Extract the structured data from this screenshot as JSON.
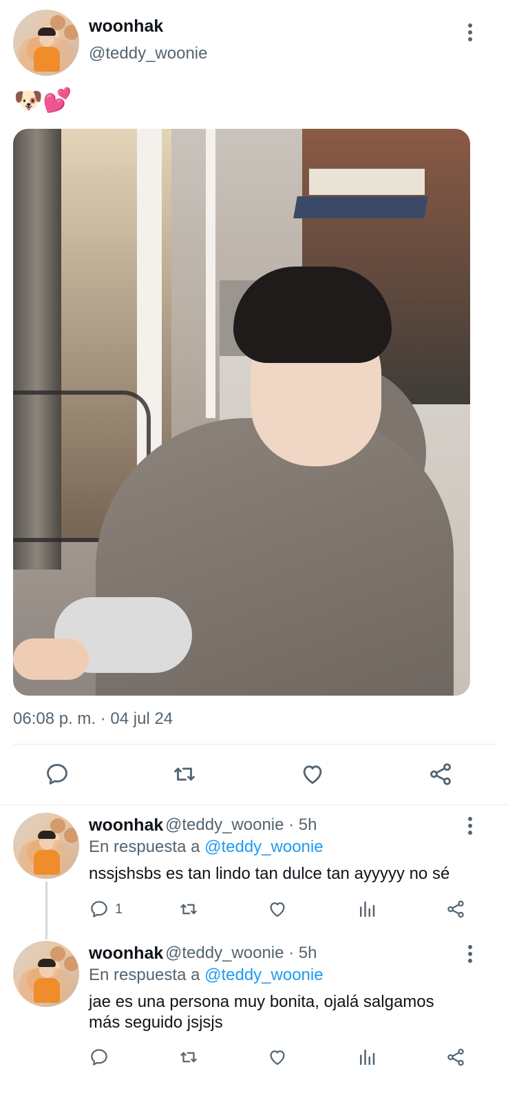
{
  "main_tweet": {
    "name": "woonhak",
    "handle": "@teddy_woonie",
    "text": "🐶💕",
    "timestamp": "06:08 p. m. · 04 jul 24"
  },
  "replies": [
    {
      "name": "woonhak",
      "handle_time": "@teddy_woonie · 5h",
      "reply_prefix": "En respuesta a",
      "reply_mention": "@teddy_woonie",
      "text": "nssjshsbs es tan lindo tan dulce tan ayyyyy no sé",
      "reply_count": "1"
    },
    {
      "name": "woonhak",
      "handle_time": "@teddy_woonie · 5h",
      "reply_prefix": "En respuesta a",
      "reply_mention": "@teddy_woonie",
      "text_line1": "jae es una persona muy bonita, ojalá salgamos",
      "text_line2": "más seguido jsjsjs",
      "reply_count": ""
    }
  ],
  "icons": [
    "more-vertical-icon",
    "reply-icon",
    "retweet-icon",
    "like-icon",
    "views-icon",
    "share-icon"
  ],
  "colors": {
    "text": "#0f1419",
    "secondary": "#536471",
    "link": "#1d9bf0",
    "divider": "#e6ecf0"
  }
}
